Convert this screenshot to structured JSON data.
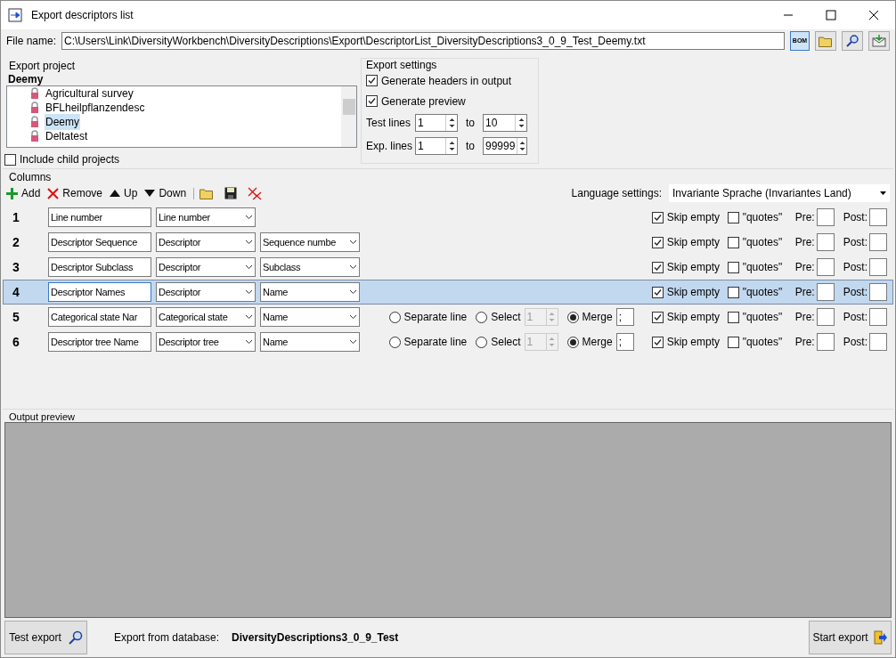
{
  "window": {
    "title": "Export descriptors list"
  },
  "file_name": {
    "label": "File name:",
    "value": "C:\\Users\\Link\\DiversityWorkbench\\DiversityDescriptions\\Export\\DescriptorList_DiversityDescriptions3_0_9_Test_Deemy.txt",
    "bom_label": "BOM"
  },
  "export_project": {
    "title": "Export project",
    "current": "Deemy",
    "items": [
      {
        "label": "Agricultural survey",
        "selected": false
      },
      {
        "label": "BFLheilpflanzendesc",
        "selected": false
      },
      {
        "label": "Deemy",
        "selected": true
      },
      {
        "label": "Deltatest",
        "selected": false
      }
    ],
    "include_child": {
      "label": "Include child projects",
      "checked": false
    }
  },
  "export_settings": {
    "title": "Export settings",
    "options": [
      {
        "label": "Generate headers in output",
        "checked": true
      },
      {
        "label": "Generate preview",
        "checked": true
      }
    ],
    "ranges": [
      {
        "label": "Test lines",
        "from": "1",
        "to_label": "to",
        "to": "10"
      },
      {
        "label": "Exp. lines",
        "from": "1",
        "to_label": "to",
        "to": "99999"
      }
    ]
  },
  "columns": {
    "title": "Columns",
    "toolbar": [
      {
        "kind": "add",
        "label": "Add"
      },
      {
        "kind": "remove",
        "label": "Remove"
      },
      {
        "kind": "up",
        "label": "Up"
      },
      {
        "kind": "down",
        "label": "Down"
      },
      {
        "kind": "open"
      },
      {
        "kind": "save"
      },
      {
        "kind": "clear"
      }
    ],
    "language": {
      "label": "Language settings:",
      "value": "Invariante Sprache (Invariantes Land)"
    },
    "rows": [
      {
        "number": "1",
        "name": "Line number",
        "type": "Line number",
        "selected": false,
        "skip_empty": {
          "label": "Skip empty",
          "checked": true
        },
        "quotes": {
          "label": "\"quotes\"",
          "checked": false
        },
        "pre": "Pre:",
        "post": "Post:"
      },
      {
        "number": "2",
        "name": "Descriptor Sequence",
        "type": "Descriptor",
        "subtype": "Sequence numbe",
        "selected": false,
        "skip_empty": {
          "label": "Skip empty",
          "checked": true
        },
        "quotes": {
          "label": "\"quotes\"",
          "checked": false
        },
        "pre": "Pre:",
        "post": "Post:"
      },
      {
        "number": "3",
        "name": "Descriptor Subclass",
        "type": "Descriptor",
        "subtype": "Subclass",
        "selected": false,
        "skip_empty": {
          "label": "Skip empty",
          "checked": true
        },
        "quotes": {
          "label": "\"quotes\"",
          "checked": false
        },
        "pre": "Pre:",
        "post": "Post:"
      },
      {
        "number": "4",
        "name": "Descriptor Names",
        "type": "Descriptor",
        "subtype": "Name",
        "selected": true,
        "skip_empty": {
          "label": "Skip empty",
          "checked": true
        },
        "quotes": {
          "label": "\"quotes\"",
          "checked": false
        },
        "pre": "Pre:",
        "post": "Post:"
      },
      {
        "number": "5",
        "name": "Categorical state Nar",
        "type": "Categorical state",
        "subtype": "Name",
        "selected": false,
        "modes": [
          {
            "label": "Separate line",
            "selected": false
          },
          {
            "label": "Select",
            "selected": false,
            "value": "1"
          },
          {
            "label": "Merge",
            "selected": true,
            "value": ";"
          }
        ],
        "skip_empty": {
          "label": "Skip empty",
          "checked": true
        },
        "quotes": {
          "label": "\"quotes\"",
          "checked": false
        },
        "pre": "Pre:",
        "post": "Post:"
      },
      {
        "number": "6",
        "name": "Descriptor tree Name",
        "type": "Descriptor tree",
        "subtype": "Name",
        "selected": false,
        "modes": [
          {
            "label": "Separate line",
            "selected": false
          },
          {
            "label": "Select",
            "selected": false,
            "value": "1"
          },
          {
            "label": "Merge",
            "selected": true,
            "value": ";"
          }
        ],
        "skip_empty": {
          "label": "Skip empty",
          "checked": true
        },
        "quotes": {
          "label": "\"quotes\"",
          "checked": false
        },
        "pre": "Pre:",
        "post": "Post:"
      }
    ]
  },
  "output_preview": {
    "title": "Output preview"
  },
  "footer": {
    "test_button": "Test export",
    "db_label": "Export from database:",
    "db_name": "DiversityDescriptions3_0_9_Test",
    "start_button": "Start export"
  }
}
